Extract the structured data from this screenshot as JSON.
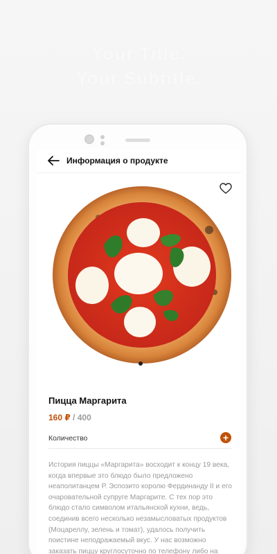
{
  "hero": {
    "title": "Your Title.",
    "subtitle": "Your Subtitle."
  },
  "appbar": {
    "title": "Информация о продукте",
    "back_icon": "arrow-left-icon"
  },
  "product": {
    "favorite_icon": "heart-icon",
    "image": "margherita-pizza-image",
    "name": "Пицца Маргарита",
    "price_current": "160 ₽",
    "price_separator": " / ",
    "price_old": "400",
    "quantity_label": "Количество",
    "add_icon": "plus-icon",
    "description": "История пиццы «Маргарита» восходит к концу 19 века, когда впервые это блюдо было предложено неаполитанцем Р. Эспозито королю Фердинанду II и его очаровательной супруге Маргарите. С тех пор это блюдо стало символом итальянской кухни, ведь, соединив всего несколько незамысловатых продуктов (Моцареллу, зелень и томат), удалось получить поистине неподражаемый вкус. У нас возможно заказать пиццу круглосуточно по телефону либо на нашем сайте. Доставка пиццы «Маргарита»..."
  },
  "colors": {
    "accent": "#c0520a",
    "text_primary": "#111111",
    "text_muted": "#9a9a9a"
  }
}
